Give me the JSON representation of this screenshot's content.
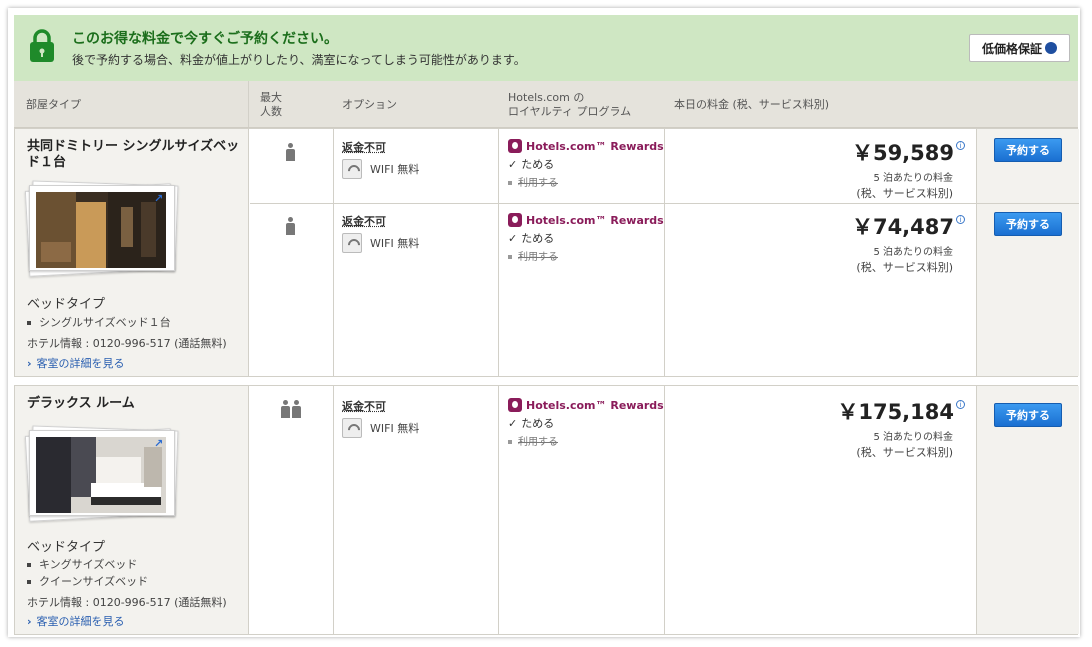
{
  "banner": {
    "title": "このお得な料金で今すぐご予約ください。",
    "subtitle": "後で予約する場合、料金が値上がりしたり、満室になってしまう可能性があります。",
    "guarantee_label": "低価格保証"
  },
  "header": {
    "room_type": "部屋タイプ",
    "max_guests": "最大\n人数",
    "options": "オプション",
    "loyalty": "Hotels.com の\nロイヤルティ プログラム",
    "price": "本日の料金 (税、サービス料別)"
  },
  "rooms": [
    {
      "name": "共同ドミトリー シングルサイズベッド１台",
      "bed_heading": "ベッドタイプ",
      "beds": [
        "シングルサイズベッド１台"
      ],
      "hotel_info": "ホテル情報 : 0120-996-517 (通話無料)",
      "details_link": "客室の詳細を見る",
      "rates": [
        {
          "guests": 1,
          "non_refundable": "返金不可",
          "wifi": "WIFI 無料",
          "rewards_title": "Hotels.com™ Rewards",
          "earn": "ためる",
          "use": "利用する",
          "price": "￥59,589",
          "nights": "5 泊あたりの料金",
          "tax": "(税、サービス料別)",
          "book": "予約する"
        },
        {
          "guests": 1,
          "non_refundable": "返金不可",
          "wifi": "WIFI 無料",
          "rewards_title": "Hotels.com™ Rewards",
          "earn": "ためる",
          "use": "利用する",
          "price": "￥74,487",
          "nights": "5 泊あたりの料金",
          "tax": "(税、サービス料別)",
          "book": "予約する"
        }
      ]
    },
    {
      "name": "デラックス ルーム",
      "bed_heading": "ベッドタイプ",
      "beds": [
        "キングサイズベッド",
        "クイーンサイズベッド"
      ],
      "hotel_info": "ホテル情報 : 0120-996-517 (通話無料)",
      "details_link": "客室の詳細を見る",
      "rates": [
        {
          "guests": 2,
          "non_refundable": "返金不可",
          "wifi": "WIFI 無料",
          "rewards_title": "Hotels.com™ Rewards",
          "earn": "ためる",
          "use": "利用する",
          "price": "￥175,184",
          "nights": "5 泊あたりの料金",
          "tax": "(税、サービス料別)",
          "book": "予約する"
        }
      ]
    }
  ],
  "icons": {
    "lock": "lock-icon",
    "info": "info-icon",
    "wifi": "wifi-icon",
    "person": "person-icon",
    "rewards": "rewards-logo-icon",
    "expand": "expand-arrow-icon",
    "chevron": "chevron-right-icon"
  },
  "colors": {
    "banner_bg": "#cfe7c3",
    "banner_title": "#1b6e1b",
    "rewards": "#8a1c5a",
    "book_button": "#1a6fd1",
    "link": "#2a5fb0"
  }
}
